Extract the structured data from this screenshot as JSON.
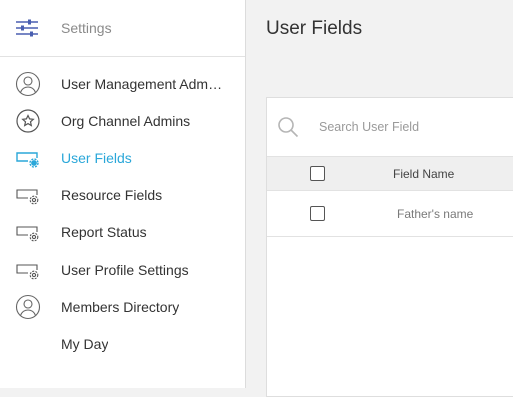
{
  "sidebar": {
    "header_title": "Settings",
    "header_icon": "sliders-icon",
    "items": [
      {
        "label": "User Management Admins",
        "icon": "user-circle-icon"
      },
      {
        "label": "Org Channel Admins",
        "icon": "star-circle-icon"
      },
      {
        "label": "User Fields",
        "icon": "field-gear-icon",
        "active": true
      },
      {
        "label": "Resource Fields",
        "icon": "field-gear-icon"
      },
      {
        "label": "Report Status",
        "icon": "field-gear-icon"
      },
      {
        "label": "User Profile Settings",
        "icon": "field-gear-icon"
      },
      {
        "label": "Members Directory",
        "icon": "user-circle-icon"
      },
      {
        "label": "My Day",
        "icon": ""
      }
    ]
  },
  "main": {
    "title": "User Fields",
    "search": {
      "placeholder": "Search User Field"
    },
    "table": {
      "columns": [
        "Field Name"
      ],
      "rows": [
        {
          "field_name": "Father's name"
        }
      ]
    }
  },
  "colors": {
    "accent": "#2aa7d9",
    "text": "#333333",
    "muted": "#8a8a8a",
    "background": "#f2f2f2"
  }
}
